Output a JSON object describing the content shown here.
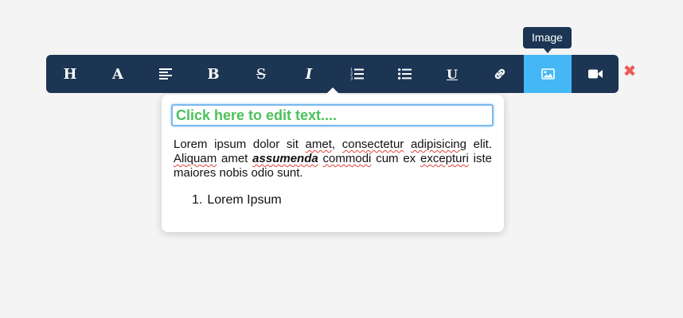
{
  "tooltip": {
    "text": "Image"
  },
  "toolbar": {
    "buttons": [
      {
        "name": "heading",
        "glyph": "H"
      },
      {
        "name": "font",
        "glyph": "A"
      },
      {
        "name": "align",
        "icon": "align-left-icon"
      },
      {
        "name": "bold",
        "glyph": "B"
      },
      {
        "name": "strikethrough",
        "glyph": "S"
      },
      {
        "name": "italic",
        "glyph": "I"
      },
      {
        "name": "ordered-list",
        "icon": "ordered-list-icon"
      },
      {
        "name": "unordered-list",
        "icon": "unordered-list-icon"
      },
      {
        "name": "underline",
        "glyph": "U"
      },
      {
        "name": "link",
        "icon": "link-icon"
      },
      {
        "name": "image",
        "icon": "image-icon",
        "active": true
      },
      {
        "name": "video",
        "icon": "video-camera-icon"
      }
    ],
    "colors": {
      "background": "#1c3553",
      "active": "#44b7f6"
    }
  },
  "close": {
    "glyph": "✖",
    "color": "#f05a5a"
  },
  "editor": {
    "title_value": "Click here to edit text....",
    "title_color": "#4cc15a",
    "paragraph": {
      "part1": "Lorem ipsum dolor sit ",
      "w_amet": "amet",
      "part2": ", ",
      "w_consectetur": "consectetur",
      "part3": " ",
      "w_adipisicing": "adipisicing",
      "part4": " elit. ",
      "w_aliquam": "Aliquam",
      "part5": " amet ",
      "w_assumenda": "assumenda",
      "part6": " ",
      "w_commodi": "commodi",
      "part7": " cum ex ",
      "w_excepturi": "excepturi",
      "part8": " iste maiores nobis odio sunt."
    },
    "list": [
      {
        "number": "1.",
        "text": "Lorem Ipsum"
      }
    ]
  }
}
